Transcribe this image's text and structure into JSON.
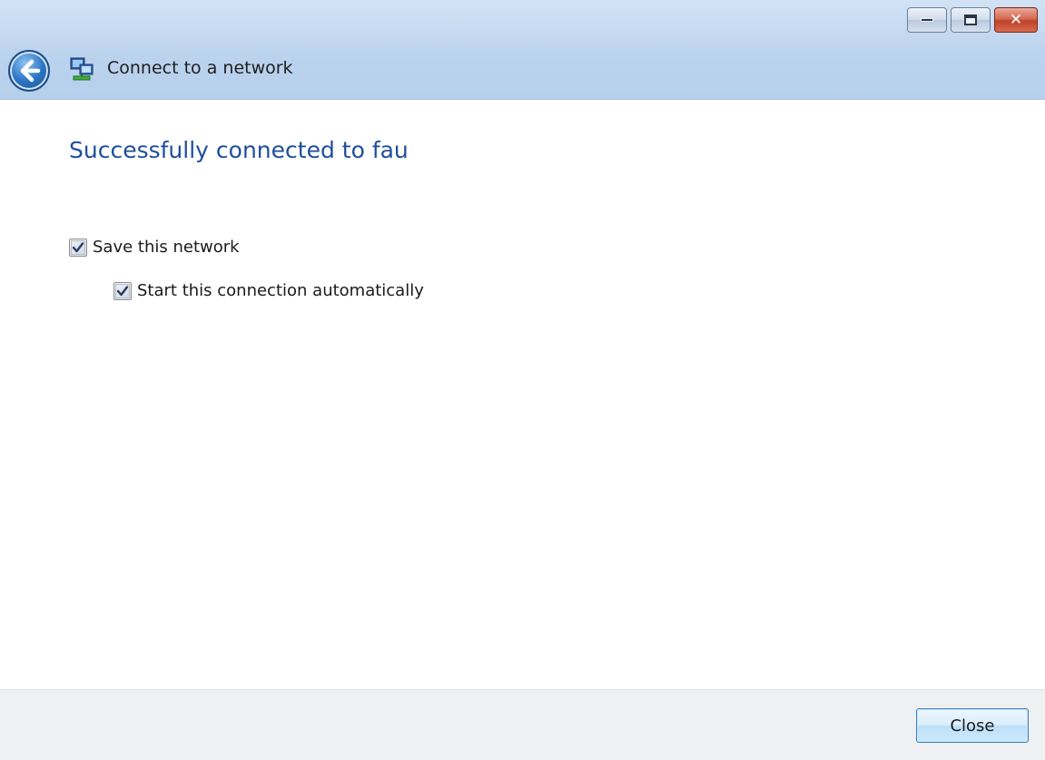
{
  "window": {
    "title": "Connect to a network",
    "controls": {
      "minimize": "minimize-icon",
      "maximize": "maximize-icon",
      "close": "close-icon"
    },
    "back_icon": "back-arrow-icon",
    "title_icon": "network-icon"
  },
  "main": {
    "heading": "Successfully connected to fau",
    "options": [
      {
        "label": "Save this network",
        "checked": true
      },
      {
        "label": "Start this connection automatically",
        "checked": true
      }
    ]
  },
  "footer": {
    "close_label": "Close"
  },
  "colors": {
    "heading": "#1f4e9c",
    "titlebar": "#bcd3ee",
    "footer_bg": "#eff0f2",
    "button_border": "#3b7fbf"
  }
}
